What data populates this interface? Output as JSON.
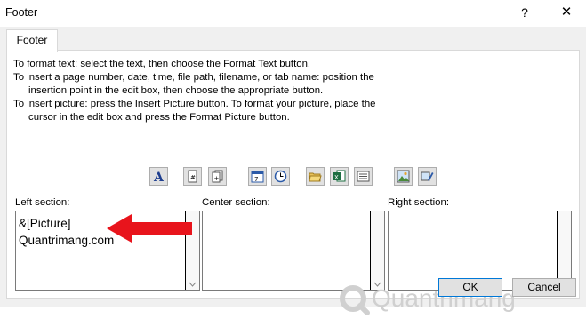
{
  "window": {
    "title": "Footer",
    "help_glyph": "?",
    "close_glyph": "✕"
  },
  "tab": {
    "label": "Footer"
  },
  "instructions": [
    "To format text:  select the text, then choose the Format Text button.",
    "To insert a page number, date, time, file path, filename, or tab name:  position the",
    "insertion point in the edit box, then choose the appropriate button.",
    "To insert picture: press the Insert Picture button.  To format your picture, place the",
    "cursor in the edit box and press the Format Picture button."
  ],
  "toolbar_icons": [
    "format-text-icon",
    "insert-page-number-icon",
    "insert-number-of-pages-icon",
    "insert-date-icon",
    "insert-time-icon",
    "insert-file-path-icon",
    "insert-file-name-icon",
    "insert-sheet-name-icon",
    "insert-picture-icon",
    "format-picture-icon"
  ],
  "sections": {
    "left": {
      "label": "Left section:",
      "lines": [
        "&[Picture]",
        "Quantrimang.com"
      ]
    },
    "center": {
      "label": "Center section:"
    },
    "right": {
      "label": "Right section:"
    }
  },
  "watermark": {
    "text": "Quantrimang",
    "color": "#d0d0d0"
  },
  "buttons": {
    "ok": "OK",
    "cancel": "Cancel"
  },
  "colors": {
    "arrow": "#e8141c",
    "accent": "#0078d7"
  }
}
